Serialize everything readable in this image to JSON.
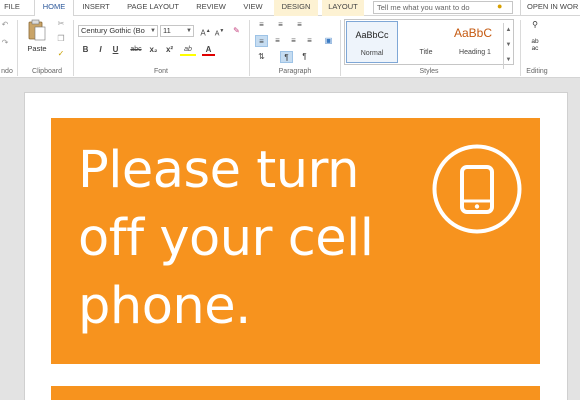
{
  "tabs": {
    "file": "FILE",
    "home": "HOME",
    "insert": "INSERT",
    "page_layout": "PAGE LAYOUT",
    "review": "REVIEW",
    "view": "VIEW",
    "design": "DESIGN",
    "layout": "LAYOUT"
  },
  "tell_me": {
    "placeholder": "Tell me what you want to do"
  },
  "open_in": "OPEN IN WOR",
  "ribbon": {
    "undo_label": "ndo",
    "clipboard": {
      "paste": "Paste",
      "group": "Clipboard"
    },
    "font": {
      "family": "Century Gothic (Bo",
      "size": "11",
      "grow": "A",
      "shrink": "A",
      "bold": "B",
      "italic": "I",
      "underline": "U",
      "strike": "abc",
      "subscript": "x₂",
      "superscript": "x²",
      "highlight": "ab",
      "font_color": "A",
      "group": "Font"
    },
    "paragraph": {
      "group": "Paragraph"
    },
    "styles": {
      "items": [
        {
          "preview": "AaBbCc",
          "name": "Normal"
        },
        {
          "preview": "",
          "name": "Title"
        },
        {
          "preview": "AaBbC",
          "name": "Heading 1"
        }
      ],
      "group": "Styles"
    },
    "editing": {
      "group": "Editing"
    }
  },
  "document": {
    "headline": [
      "Please turn",
      "off your cell",
      "phone."
    ]
  },
  "colors": {
    "banner": "#f7931e",
    "accent": "#2b579a",
    "heading_style": "#c55a11"
  }
}
